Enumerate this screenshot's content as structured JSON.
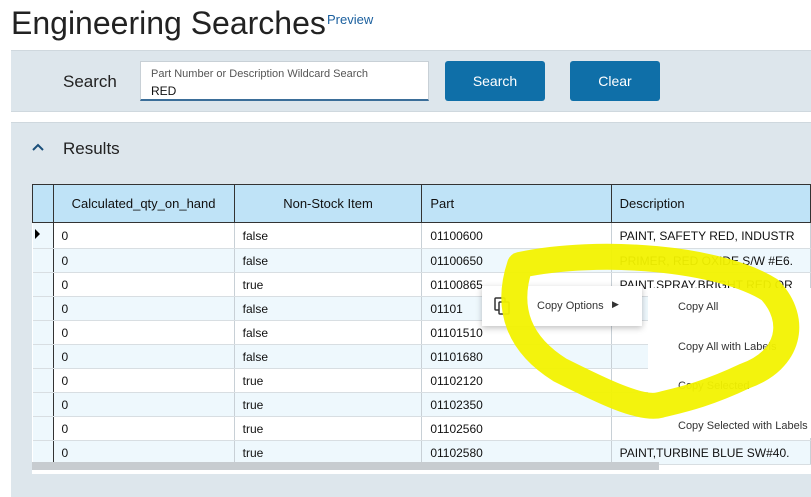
{
  "page": {
    "title": "Engineering Searches",
    "preview_link": "Preview"
  },
  "search": {
    "label": "Search",
    "placeholder": "Part Number or Description Wildcard Search",
    "value": "RED",
    "search_button": "Search",
    "clear_button": "Clear"
  },
  "results": {
    "title": "Results",
    "columns": [
      "Calculated_qty_on_hand",
      "Non-Stock Item",
      "Part",
      "Description"
    ],
    "rows": [
      [
        "0",
        "false",
        "01100600",
        "PAINT, SAFETY RED, INDUSTR"
      ],
      [
        "0",
        "false",
        "01100650",
        "PRIMER, RED OXIDE S/W #E6."
      ],
      [
        "0",
        "true",
        "01100865",
        "PAINT.SPRAY.BRIGHT RED OR"
      ],
      [
        "0",
        "false",
        "01101",
        ""
      ],
      [
        "0",
        "false",
        "01101510",
        ""
      ],
      [
        "0",
        "false",
        "01101680",
        ""
      ],
      [
        "0",
        "true",
        "01102120",
        ""
      ],
      [
        "0",
        "true",
        "01102350",
        ""
      ],
      [
        "0",
        "true",
        "01102560",
        ""
      ],
      [
        "0",
        "true",
        "01102580",
        "PAINT,TURBINE BLUE SW#40."
      ]
    ]
  },
  "context_menu": {
    "item": "Copy Options",
    "icon": "copy-icon",
    "submenu": [
      "Copy All",
      "Copy All with Labels",
      "Copy Selected",
      "Copy Selected with Labels"
    ]
  },
  "colors": {
    "accent": "#0f6fa8",
    "header_cell": "#bfe3f7",
    "panel": "#dde6ec",
    "highlight": "#f2f200"
  }
}
